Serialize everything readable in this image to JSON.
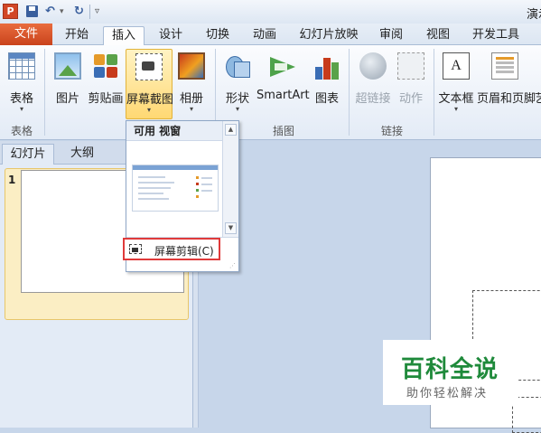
{
  "window": {
    "app_badge": "P",
    "title": "演示"
  },
  "quick_access": {
    "undo": "↶",
    "undo_dropdown": "▾",
    "redo": "↻",
    "customize": "▿"
  },
  "tabs": [
    {
      "label": "文件"
    },
    {
      "label": "开始"
    },
    {
      "label": "插入"
    },
    {
      "label": "设计"
    },
    {
      "label": "切换"
    },
    {
      "label": "动画"
    },
    {
      "label": "幻灯片放映"
    },
    {
      "label": "审阅"
    },
    {
      "label": "视图"
    },
    {
      "label": "开发工具"
    }
  ],
  "ribbon": {
    "groups": {
      "tables": "表格",
      "images": "图",
      "illustrations": "插图",
      "links": "链接"
    },
    "buttons": {
      "table": "表格",
      "picture": "图片",
      "clipart": "剪贴画",
      "screenshot": "屏幕截图",
      "album": "相册",
      "shapes": "形状",
      "smartart": "SmartArt",
      "chart": "图表",
      "hyperlink": "超链接",
      "action": "动作",
      "textbox": "文本框",
      "header_footer": "页眉和页脚",
      "more": "艺"
    },
    "textbox_icon_text": "A",
    "dropdown_arrow": "▾"
  },
  "left_panel": {
    "tabs": [
      "幻灯片",
      "大纲"
    ],
    "slide_number": "1"
  },
  "screenshot_gallery": {
    "header": "可用 视窗",
    "clip_label": "屏幕剪辑(C)",
    "scroll_up": "▲",
    "scroll_down": "▼",
    "grip": "⋰"
  },
  "watermark": {
    "title": "百科全说",
    "subtitle": "助你轻松解决"
  },
  "colors": {
    "file_tab": "#d24726",
    "highlight": "#ffd873",
    "clip_border": "#e03a3a",
    "watermark_green": "#1f8a3b"
  }
}
